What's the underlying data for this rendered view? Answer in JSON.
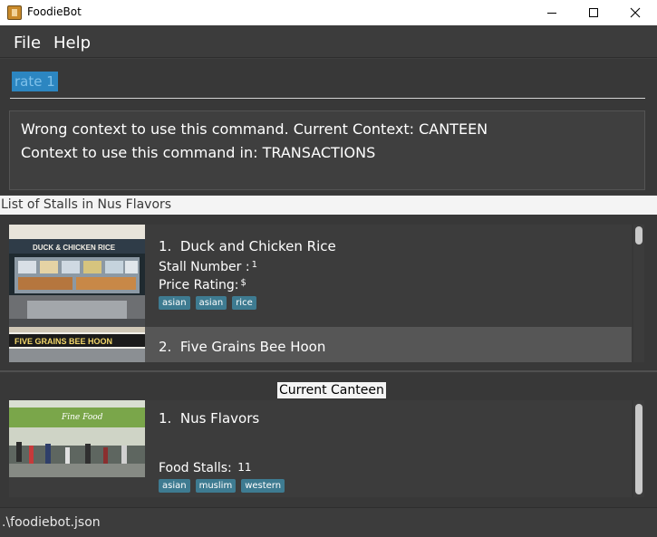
{
  "window": {
    "title": "FoodieBot"
  },
  "menu": {
    "file": "File",
    "help": "Help"
  },
  "command": {
    "value": "rate 1"
  },
  "result": {
    "line1": "Wrong context to use this command. Current Context: CANTEEN",
    "line2": "Context to use this command in: TRANSACTIONS"
  },
  "stall_list": {
    "header": "List of Stalls in Nus Flavors",
    "items": [
      {
        "index": "1.",
        "name": "Duck and Chicken Rice",
        "stall_number_label": "Stall Number :",
        "stall_number": "1",
        "price_rating_label": "Price Rating:",
        "price_rating": "$",
        "tags": [
          "asian",
          "asian",
          "rice"
        ],
        "image_sign": "DUCK & CHICKEN RICE"
      },
      {
        "index": "2.",
        "name": "Five Grains Bee Hoon",
        "image_sign": "FIVE GRAINS BEE HOON"
      }
    ]
  },
  "current_canteen": {
    "label": "Current Canteen",
    "index": "1.",
    "name": "Nus Flavors",
    "food_stalls_label": "Food Stalls:",
    "food_stalls": "11",
    "tags": [
      "asian",
      "muslim",
      "western"
    ],
    "image_sign": "Fine Food"
  },
  "status": {
    "path": ".\\foodiebot.json"
  }
}
